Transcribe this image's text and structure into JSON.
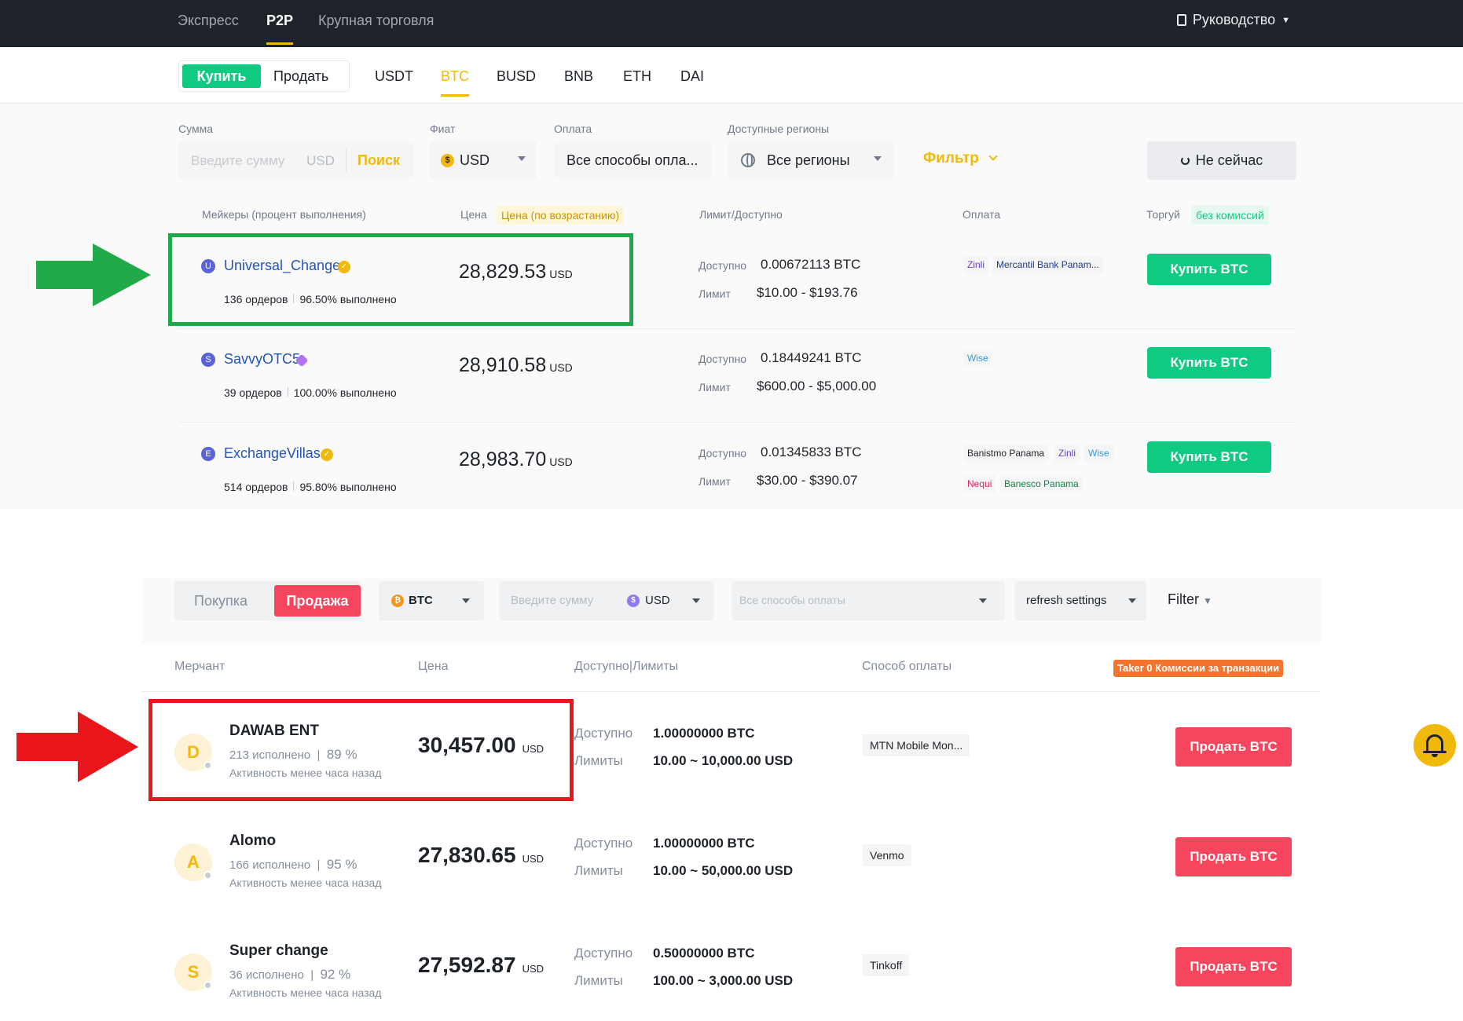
{
  "top": {
    "nav": {
      "items": [
        {
          "label": "Экспресс"
        },
        {
          "label": "P2P"
        },
        {
          "label": "Крупная торговля"
        }
      ],
      "guide_label": "Руководство"
    },
    "tabs": {
      "buy_label": "Купить",
      "sell_label": "Продать",
      "currencies": [
        "USDT",
        "BTC",
        "BUSD",
        "BNB",
        "ETH",
        "DAI"
      ],
      "active_currency": "BTC"
    },
    "filters": {
      "amount_label": "Сумма",
      "amount_placeholder": "Введите сумму",
      "amount_currency": "USD",
      "search_label": "Поиск",
      "fiat_label": "Фиат",
      "fiat_coin": "$",
      "fiat_value": "USD",
      "payment_label": "Оплата",
      "payment_value": "Все способы опла...",
      "regions_label": "Доступные регионы",
      "regions_value": "Все регионы",
      "filter_label": "Фильтр",
      "not_now_label": "Не сейчас"
    },
    "table": {
      "headers": {
        "makers": "Мейкеры (процент выполнения)",
        "price": "Цена",
        "price_sort": "Цена (по возрастанию)",
        "limit": "Лимит/Доступно",
        "payment": "Оплата",
        "trade": "Торгуй",
        "no_fee": "без комиссий"
      },
      "available_label": "Доступно",
      "limit_label": "Лимит",
      "currency": "USD",
      "buy_button": "Купить BTC",
      "rows": [
        {
          "initial": "U",
          "name": "Universal_Change",
          "orders": "136 ордеров",
          "completion": "96.50% выполнено",
          "price": "28,829.53",
          "available": "0.00672113 BTC",
          "limit": "$10.00 - $193.76",
          "payments": [
            {
              "label": "Zinli",
              "color": "#6b3ec9"
            },
            {
              "label": "Mercantil Bank Panam...",
              "color": "#1e3a8a"
            }
          ]
        },
        {
          "initial": "S",
          "name": "SavvyOTC5",
          "orders": "39 ордеров",
          "completion": "100.00% выполнено",
          "price": "28,910.58",
          "available": "0.18449241 BTC",
          "limit": "$600.00 - $5,000.00",
          "payments": [
            {
              "label": "Wise",
              "color": "#2f9be6"
            }
          ]
        },
        {
          "initial": "E",
          "name": "ExchangeVillas",
          "orders": "514 ордеров",
          "completion": "95.80% выполнено",
          "price": "28,983.70",
          "available": "0.01345833 BTC",
          "limit": "$30.00 - $390.07",
          "payments": [
            {
              "label": "Banistmo Panama",
              "color": "#1e2329"
            },
            {
              "label": "Zinli",
              "color": "#6b3ec9"
            },
            {
              "label": "Wise",
              "color": "#2f9be6"
            },
            {
              "label": "Nequi",
              "color": "#e0245e"
            },
            {
              "label": "Banesco Panama",
              "color": "#14804a"
            }
          ]
        }
      ]
    }
  },
  "bottom": {
    "filter": {
      "buy_label": "Покупка",
      "sell_label": "Продажа",
      "coin": "BTC",
      "amount_placeholder": "Введите сумму",
      "fiat": "USD",
      "payment_placeholder": "Все способы оплаты",
      "refresh": "refresh settings",
      "filter_label": "Filter"
    },
    "table": {
      "headers": {
        "merchant": "Мерчант",
        "price": "Цена",
        "limits": "Доступно|Лимиты",
        "payment": "Способ оплаты",
        "taker": "Taker 0 Комиссии за транзакции"
      },
      "available_label": "Доступно",
      "limits_label": "Лимиты",
      "currency": "USD",
      "sell_button": "Продать BTC",
      "rows": [
        {
          "initial": "D",
          "name": "DAWAB ENT",
          "orders": "213 исполнено",
          "pct": "89 %",
          "activity": "Активность менее часа назад",
          "price": "30,457.00",
          "available": "1.00000000 BTC",
          "limit": "10.00 ~ 10,000.00 USD",
          "payment": "MTN Mobile Mon..."
        },
        {
          "initial": "A",
          "name": "Alomo",
          "orders": "166 исполнено",
          "pct": "95 %",
          "activity": "Активность менее часа назад",
          "price": "27,830.65",
          "available": "1.00000000 BTC",
          "limit": "10.00 ~ 50,000.00 USD",
          "payment": "Venmo"
        },
        {
          "initial": "S",
          "name": "Super change",
          "orders": "36 исполнено",
          "pct": "92 %",
          "activity": "Активность менее часа назад",
          "price": "27,592.87",
          "available": "0.50000000 BTC",
          "limit": "100.00 ~ 3,000.00 USD",
          "payment": "Tinkoff"
        }
      ]
    }
  },
  "colors": {
    "brand": "#f0b90b",
    "buy": "#0ecb81",
    "sell": "#f6465d",
    "highlight_green": "#1fa94a",
    "highlight_red": "#e8151a"
  }
}
